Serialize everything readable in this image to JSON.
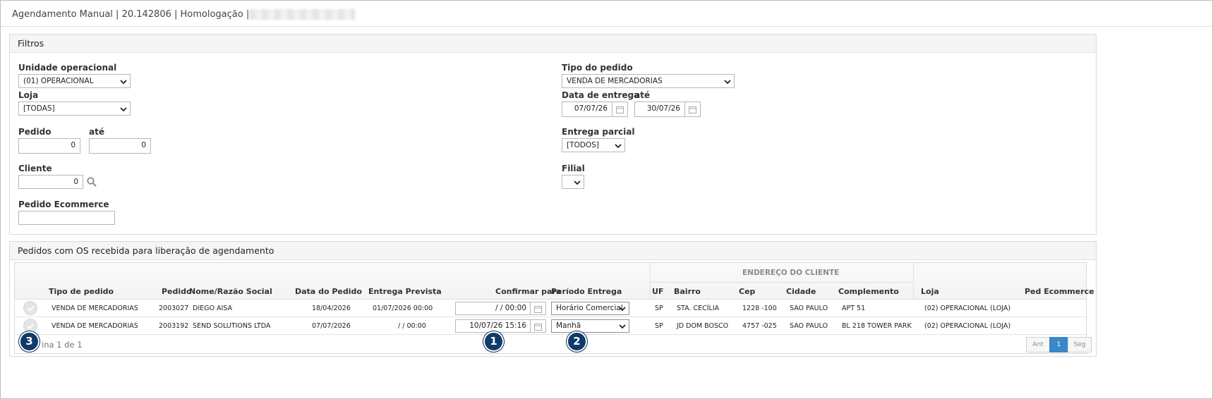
{
  "window": {
    "title": "Agendamento Manual | 20.142806 | Homologação |"
  },
  "filters": {
    "heading": "Filtros",
    "unidade_label": "Unidade operacional",
    "unidade_value": "(01) OPERACIONAL",
    "loja_label": "Loja",
    "loja_value": "[TODAS]",
    "pedido_label": "Pedido",
    "pedido_from": "0",
    "pedido_ate_label": "até",
    "pedido_to": "0",
    "cliente_label": "Cliente",
    "cliente_value": "0",
    "pedido_ecommerce_label": "Pedido Ecommerce",
    "pedido_ecommerce_value": "",
    "tipo_pedido_label": "Tipo do pedido",
    "tipo_pedido_value": "VENDA DE MERCADORIAS",
    "data_entrega_label": "Data de entrega",
    "data_entrega_from": "07/07/26",
    "data_entrega_ate_label": "até",
    "data_entrega_to": "30/07/26",
    "entrega_parcial_label": "Entrega parcial",
    "entrega_parcial_value": "[TODOS]",
    "filial_label": "Filial",
    "filial_value": ""
  },
  "orders": {
    "heading": "Pedidos com OS recebida para liberação de agendamento",
    "group_header": "ENDEREÇO DO CLIENTE",
    "columns": {
      "tipo": "Tipo de pedido",
      "pedido": "Pedido",
      "nome": "Nome/Razão Social",
      "data_pedido": "Data do Pedido",
      "entrega_prevista": "Entrega Prevista",
      "confirmar": "Confirmar para",
      "periodo": "Período Entrega",
      "uf": "UF",
      "bairro": "Bairro",
      "cep": "Cep",
      "cidade": "Cidade",
      "complemento": "Complemento",
      "loja": "Loja",
      "ped_ecommerce": "Ped Ecommerce"
    },
    "rows": [
      {
        "tipo": "VENDA DE MERCADORIAS",
        "pedido": "2003027",
        "nome": "DIEGO AISA",
        "data_pedido": "18/04/2026",
        "entrega_prevista": "01/07/2026 00:00",
        "confirmar": "/ /   00:00",
        "periodo": "Horário Comercial",
        "uf": "SP",
        "bairro": "STA. CECÍLIA",
        "cep": "1228 -100",
        "cidade": "SAO PAULO",
        "complemento": "APT 51",
        "loja": "(02) OPERACIONAL (LOJA)",
        "ped_ecommerce": ""
      },
      {
        "tipo": "VENDA DE MERCADORIAS",
        "pedido": "2003192",
        "nome": "SEND SOLUTIONS LTDA",
        "data_pedido": "07/07/2026",
        "entrega_prevista": "/ / 00:00",
        "confirmar": "10/07/26 15:16",
        "periodo": "Manhã",
        "uf": "SP",
        "bairro": "JD DOM BOSCO",
        "cep": "4757 -025",
        "cidade": "SAO PAULO",
        "complemento": "BL 218 TOWER PARK",
        "loja": "(02) OPERACIONAL (LOJA)",
        "ped_ecommerce": ""
      }
    ],
    "page_info": "ina 1 de 1",
    "pager": {
      "prev": "Ant",
      "current": "1",
      "next": "Seg"
    }
  },
  "markers": [
    "1",
    "2",
    "3"
  ],
  "colors": {
    "marker_bg": "#103a6b",
    "pager_active": "#3a87c9",
    "panel_header_bg": "#f5f5f5"
  },
  "icons": {
    "calendar": "calendar-icon",
    "search": "search-icon",
    "check": "check-circle-icon",
    "caret": "chevron-down-icon"
  }
}
